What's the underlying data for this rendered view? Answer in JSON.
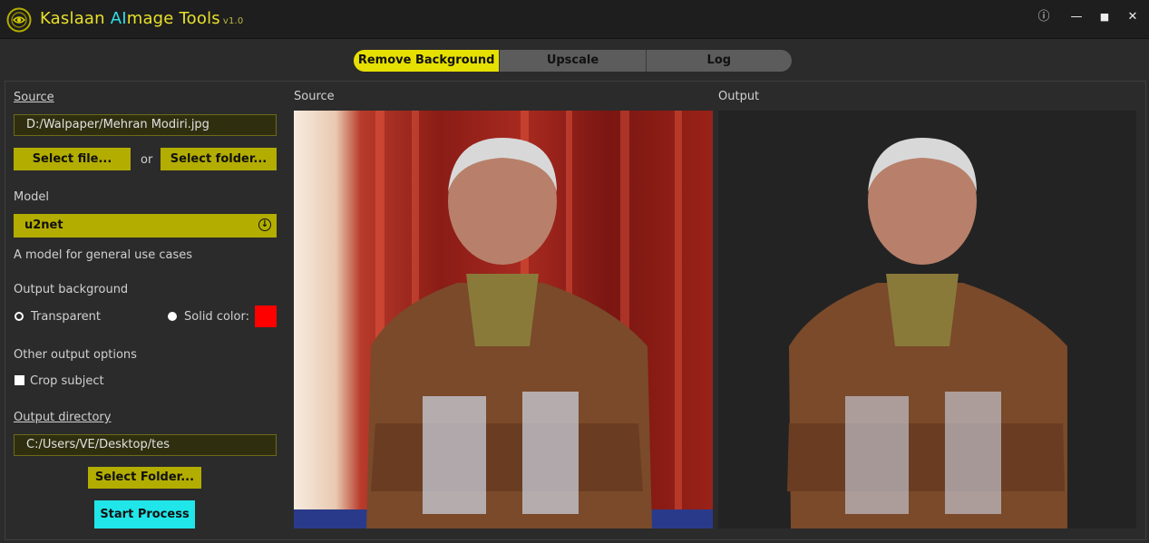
{
  "window": {
    "title_prefix": "Kaslaan ",
    "title_ai": "AI",
    "title_suffix": "mage Tools",
    "version": "v1.0",
    "controls": {
      "info": "ⓘ",
      "minimize": "—",
      "maximize": "■",
      "close": "✕"
    }
  },
  "tabs": [
    {
      "label": "Remove Background",
      "active": true
    },
    {
      "label": "Upscale",
      "active": false
    },
    {
      "label": "Log",
      "active": false
    }
  ],
  "left": {
    "source_label": "Source",
    "source_path": "D:/Walpaper/Mehran Modiri.jpg",
    "select_file": "Select file...",
    "or": "or",
    "select_folder": "Select folder...",
    "model_label": "Model",
    "model_value": "u2net",
    "model_desc": "A model for general use cases",
    "output_bg_label": "Output background",
    "transparent_label": "Transparent",
    "solid_label": "Solid color:",
    "solid_color": "#ff0000",
    "other_label": "Other output options",
    "crop_label": "Crop subject",
    "output_dir_label": "Output directory",
    "output_dir": "C:/Users/VE/Desktop/tes",
    "select_folder_btn": "Select Folder...",
    "start_btn": "Start Process"
  },
  "panels": {
    "source_title": "Source",
    "output_title": "Output"
  },
  "colors": {
    "accent_yellow": "#e6e000",
    "button_olive": "#b3ad00",
    "accent_cyan": "#20e6ea"
  }
}
